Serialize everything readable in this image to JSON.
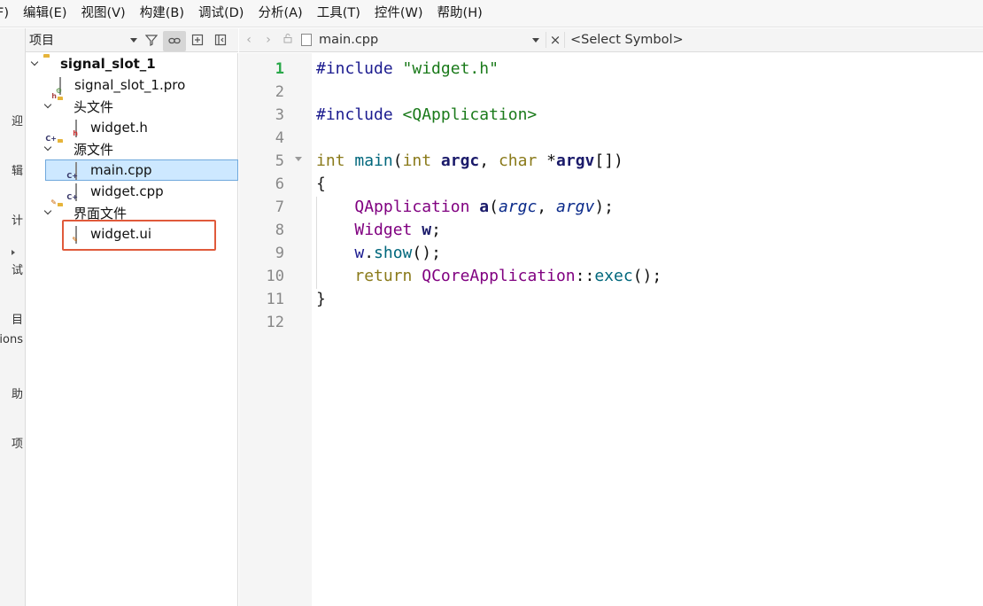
{
  "menubar": {
    "items": [
      "F)",
      "编辑(E)",
      "视图(V)",
      "构建(B)",
      "调试(D)",
      "分析(A)",
      "工具(T)",
      "控件(W)",
      "帮助(H)"
    ]
  },
  "modebar": {
    "labels": [
      "迎",
      "辑",
      "计",
      "试",
      "目",
      "ions",
      "助",
      "项"
    ]
  },
  "project_panel": {
    "selector_label": "项目",
    "tree": [
      {
        "label": "signal_slot_1",
        "icon": "project-folder-icon"
      },
      {
        "label": "signal_slot_1.pro",
        "icon": "pro-file-icon"
      },
      {
        "label": "头文件",
        "icon": "header-folder-icon",
        "badge": "h"
      },
      {
        "label": "widget.h",
        "icon": "header-file-icon",
        "badge": "h"
      },
      {
        "label": "源文件",
        "icon": "source-folder-icon",
        "badge": "C+"
      },
      {
        "label": "main.cpp",
        "icon": "cpp-file-icon",
        "badge": "C+"
      },
      {
        "label": "widget.cpp",
        "icon": "cpp-file-icon",
        "badge": "C+"
      },
      {
        "label": "界面文件",
        "icon": "forms-folder-icon"
      },
      {
        "label": "widget.ui",
        "icon": "ui-file-icon"
      }
    ]
  },
  "editor": {
    "file_name": "main.cpp",
    "close_label": "×",
    "symbol_placeholder": "<Select Symbol>",
    "line_numbers": [
      "1",
      "2",
      "3",
      "4",
      "5",
      "6",
      "7",
      "8",
      "9",
      "10",
      "11",
      "12"
    ],
    "code": {
      "l1_dir": "#include ",
      "l1_str": "\"widget.h\"",
      "l3_dir": "#include ",
      "l3_str": "<QApplication>",
      "l5_int1": "int",
      "l5_main": "main",
      "l5_open": "(",
      "l5_int2": "int",
      "l5_argc": "argc",
      "l5_comma": ", ",
      "l5_char": "char",
      "l5_star": " *",
      "l5_argv": "argv",
      "l5_end": "[])",
      "l6": "{",
      "l7_type": "QApplication",
      "l7_a": "a",
      "l7_open": "(",
      "l7_argc": "argc",
      "l7_comma": ", ",
      "l7_argv": "argv",
      "l7_end": ");",
      "l8_type": "Widget",
      "l8_w": "w",
      "l8_end": ";",
      "l9_w": "w",
      "l9_dot": ".",
      "l9_show": "show",
      "l9_end": "();",
      "l10_ret": "return",
      "l10_cls": "QCoreApplication",
      "l10_sep": "::",
      "l10_exec": "exec",
      "l10_end": "();",
      "l11": "}"
    }
  }
}
